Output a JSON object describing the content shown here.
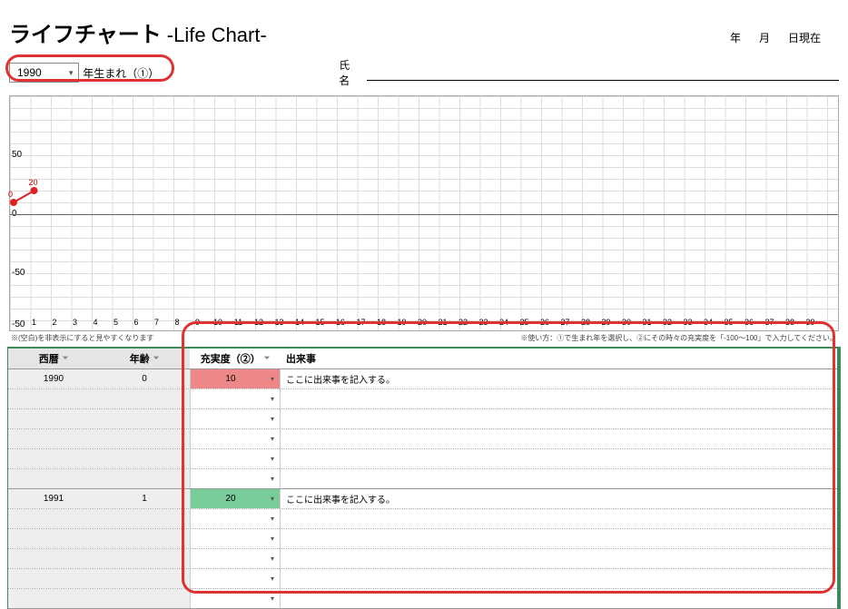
{
  "title": "ライフチャート",
  "subtitle": "-Life Chart-",
  "date_labels": {
    "y": "年",
    "m": "月",
    "d": "日現在"
  },
  "birth_year_value": "1990",
  "born_label": "年生まれ（①）",
  "name_label": "氏名",
  "note_left": "※(空白)を非表示にすると見やすくなります",
  "note_right": "※使い方：①で生まれ年を選択し、②にその時々の充実度を「-100～100」で入力してください。",
  "headers": {
    "year": "西暦",
    "age": "年齢",
    "fullness": "充実度（②）",
    "event": "出来事"
  },
  "rows": [
    {
      "year": "1990",
      "age": "0",
      "fullness": "10",
      "cell_color": "red",
      "event": "ここに出来事を記入する。"
    },
    {
      "year": "",
      "age": "",
      "fullness": "",
      "cell_color": "",
      "event": ""
    },
    {
      "year": "",
      "age": "",
      "fullness": "",
      "cell_color": "",
      "event": ""
    },
    {
      "year": "",
      "age": "",
      "fullness": "",
      "cell_color": "",
      "event": ""
    },
    {
      "year": "",
      "age": "",
      "fullness": "",
      "cell_color": "",
      "event": ""
    },
    {
      "year": "",
      "age": "",
      "fullness": "",
      "cell_color": "",
      "event": "",
      "block_end": true
    },
    {
      "year": "1991",
      "age": "1",
      "fullness": "20",
      "cell_color": "green",
      "event": "ここに出来事を記入する。"
    },
    {
      "year": "",
      "age": "",
      "fullness": "",
      "cell_color": "",
      "event": ""
    },
    {
      "year": "",
      "age": "",
      "fullness": "",
      "cell_color": "",
      "event": ""
    },
    {
      "year": "",
      "age": "",
      "fullness": "",
      "cell_color": "",
      "event": ""
    },
    {
      "year": "",
      "age": "",
      "fullness": "",
      "cell_color": "",
      "event": ""
    },
    {
      "year": "",
      "age": "",
      "fullness": "",
      "cell_color": "",
      "event": "",
      "block_end": true
    }
  ],
  "chart_data": {
    "type": "line",
    "x": [
      0,
      1
    ],
    "values": [
      10,
      20
    ],
    "x_ticks": [
      1,
      2,
      3,
      4,
      5,
      6,
      7,
      8,
      9,
      10,
      11,
      12,
      13,
      14,
      15,
      16,
      17,
      18,
      19,
      20,
      21,
      22,
      23,
      24,
      25,
      26,
      27,
      28,
      29,
      30,
      31,
      32,
      33,
      34,
      35,
      36,
      37,
      38,
      39
    ],
    "y_ticks": [
      50,
      0,
      -50,
      -50
    ],
    "value_labels": [
      "0",
      "20"
    ],
    "ylim": [
      -100,
      100
    ],
    "title": "",
    "xlabel": "",
    "ylabel": ""
  }
}
